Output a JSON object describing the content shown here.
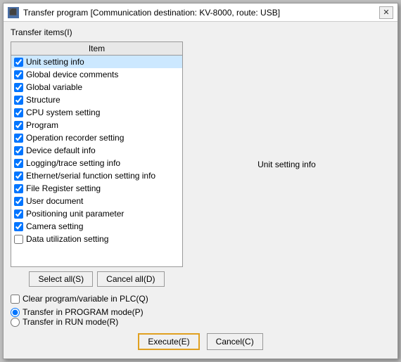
{
  "window": {
    "title": "Transfer program [Communication destination: KV-8000, route: USB]",
    "close_label": "✕"
  },
  "transfer_items_label": "Transfer items(I)",
  "list": {
    "header": "Item",
    "items": [
      {
        "label": "Unit setting info",
        "checked": true,
        "selected": true
      },
      {
        "label": "Global device comments",
        "checked": true,
        "selected": false
      },
      {
        "label": "Global variable",
        "checked": true,
        "selected": false
      },
      {
        "label": "Structure",
        "checked": true,
        "selected": false
      },
      {
        "label": "CPU system setting",
        "checked": true,
        "selected": false
      },
      {
        "label": "Program",
        "checked": true,
        "selected": false
      },
      {
        "label": "Operation recorder setting",
        "checked": true,
        "selected": false
      },
      {
        "label": "Device default info",
        "checked": true,
        "selected": false
      },
      {
        "label": "Logging/trace setting info",
        "checked": true,
        "selected": false
      },
      {
        "label": "Ethernet/serial function setting info",
        "checked": true,
        "selected": false
      },
      {
        "label": "File Register setting",
        "checked": true,
        "selected": false
      },
      {
        "label": "User document",
        "checked": true,
        "selected": false
      },
      {
        "label": "Positioning unit parameter",
        "checked": true,
        "selected": false
      },
      {
        "label": "Camera setting",
        "checked": true,
        "selected": false
      },
      {
        "label": "Data utilization setting",
        "checked": false,
        "selected": false
      }
    ]
  },
  "buttons": {
    "select_all": "Select all(S)",
    "cancel_all": "Cancel all(D)"
  },
  "clear_program_label": "Clear program/variable in PLC(Q)",
  "radio_options": [
    {
      "label": "Transfer in PROGRAM mode(P)",
      "checked": true
    },
    {
      "label": "Transfer in RUN mode(R)",
      "checked": false
    }
  ],
  "action_buttons": {
    "execute": "Execute(E)",
    "cancel": "Cancel(C)"
  },
  "info_text": "Unit setting info"
}
